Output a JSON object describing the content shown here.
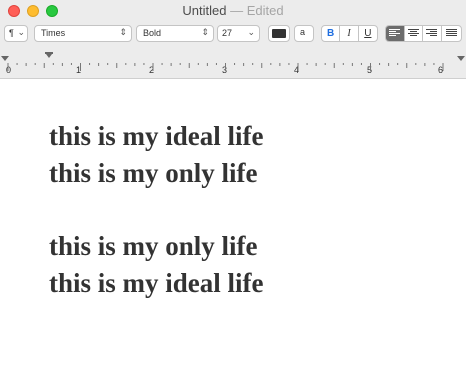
{
  "window": {
    "title": "Untitled",
    "status": "Edited",
    "separator": "—"
  },
  "toolbar": {
    "paragraph_style": "¶",
    "font_family": "Times",
    "font_style": "Bold",
    "font_size": "27",
    "text_color": "#333333",
    "background_label": "a",
    "bold_label": "B",
    "italic_label": "I",
    "underline_label": "U",
    "alignment_selected": "left"
  },
  "ruler": {
    "numbers": [
      "0",
      "1",
      "2",
      "3",
      "4",
      "5",
      "6"
    ]
  },
  "document": {
    "lines": [
      "this is my ideal life",
      "this is my only life",
      "",
      "this is my only life",
      "this is my ideal life"
    ]
  }
}
